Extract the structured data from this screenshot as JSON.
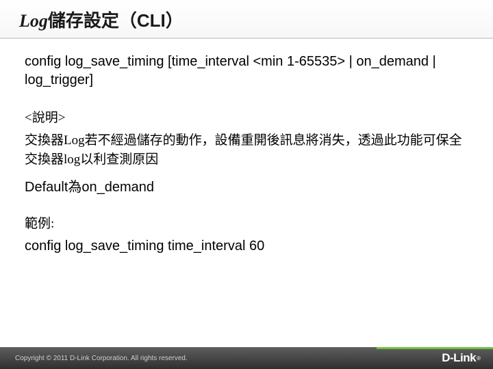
{
  "title": {
    "prefix": "Log",
    "zh": "儲存設定（CLI）"
  },
  "syntax": "config log_save_timing [time_interval <min 1-65535> | on_demand | log_trigger]",
  "labels": {
    "explain": "<說明>",
    "example": "範例:"
  },
  "description": "交換器Log若不經過儲存的動作，設備重開後訊息將消失，透過此功能可保全交換器log以利查測原因",
  "default_line": "Default為on_demand",
  "example_cmd": "config log_save_timing time_interval 60",
  "footer": {
    "copyright": "Copyright © 2011 D-Link Corporation. All rights reserved.",
    "brand": "D-Link",
    "reg": "®"
  }
}
